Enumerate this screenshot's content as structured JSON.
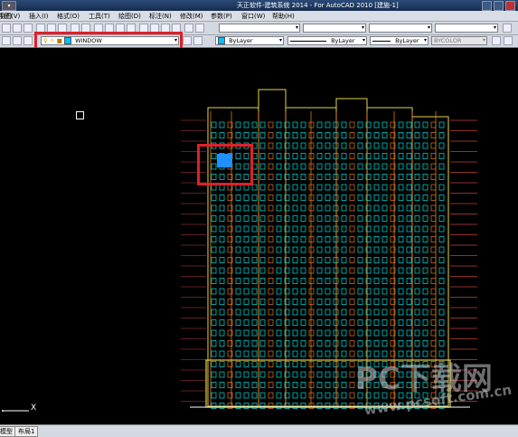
{
  "window": {
    "title": "天正软件-建筑系统 2014 - For AutoCAD 2010   [建施-1]"
  },
  "menu": [
    "文件(F)",
    "编辑(E)",
    "视图(V)",
    "插入(I)",
    "格式(O)",
    "工具(T)",
    "绘图(D)",
    "标注(N)",
    "修改(M)",
    "参数(P)",
    "窗口(W)",
    "帮助(H)"
  ],
  "layer_combo": {
    "value": "WINDOW",
    "color": "#00bfff"
  },
  "color_combo": {
    "value": "ByLayer",
    "color": "#00bfff"
  },
  "linetype_combo": {
    "value": "ByLayer"
  },
  "lineweight_combo": {
    "value": "ByLayer"
  },
  "plotstyle_combo": {
    "value": "BYCOLOR"
  },
  "tabs": {
    "model": "模型",
    "layout1": "布局1"
  },
  "ucs": {
    "x_label": "X"
  },
  "watermark": {
    "line1": "PC下载网",
    "line2": "www.pcsoft.com.cn"
  },
  "colors": {
    "highlight_box": "#e0202a",
    "selected_window": "#1e90ff",
    "building_cyan": "#00e0e0",
    "building_yellow": "#e6d34a",
    "building_orange": "#e07a1a"
  }
}
